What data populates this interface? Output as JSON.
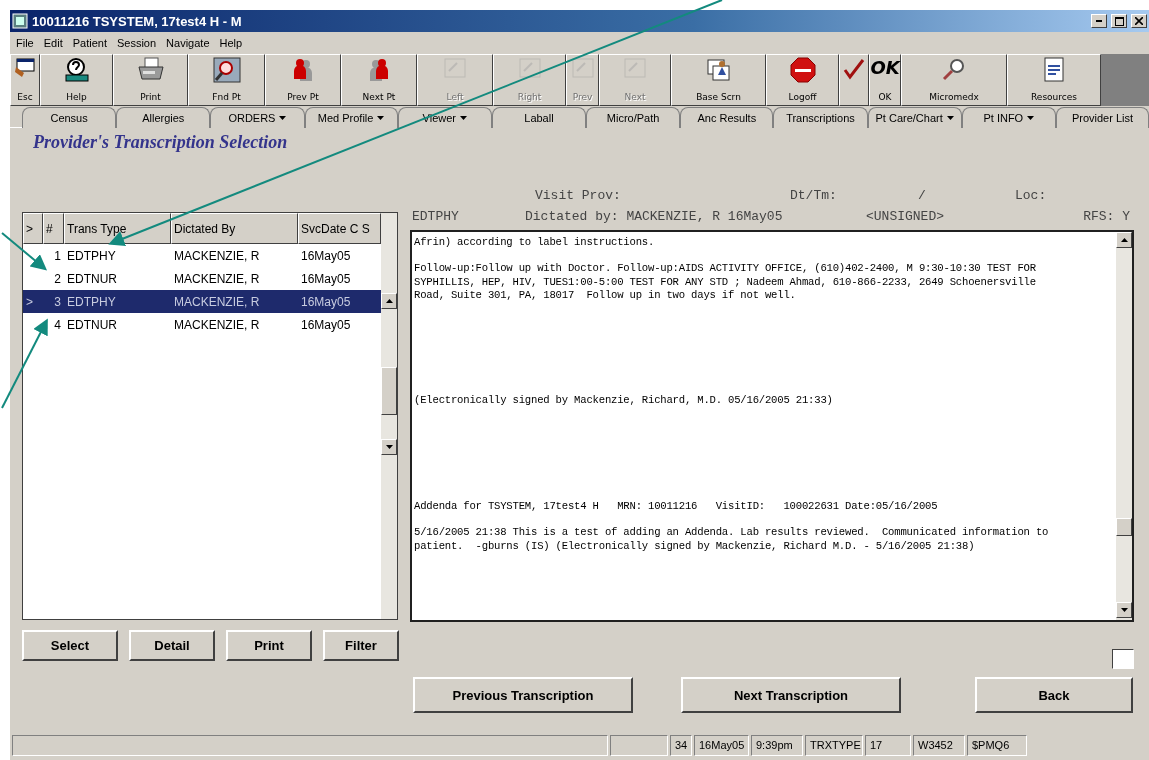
{
  "window": {
    "title": "10011216 TSYSTEM, 17test4 H - M"
  },
  "menu": [
    "File",
    "Edit",
    "Patient",
    "Session",
    "Navigate",
    "Help"
  ],
  "toolbar": [
    {
      "label": "Esc",
      "kind": "esc",
      "disabled": false
    },
    {
      "label": "Help",
      "kind": "help",
      "disabled": false
    },
    {
      "label": "Print",
      "kind": "print",
      "disabled": false
    },
    {
      "label": "Fnd Pt",
      "kind": "find",
      "disabled": false
    },
    {
      "label": "Prev Pt",
      "kind": "prevpt",
      "disabled": false
    },
    {
      "label": "Next Pt",
      "kind": "nextpt",
      "disabled": false
    },
    {
      "label": "Left",
      "kind": "page",
      "disabled": true
    },
    {
      "label": "Right",
      "kind": "page",
      "disabled": true
    },
    {
      "label": "Prev",
      "kind": "page",
      "disabled": true
    },
    {
      "label": "Next",
      "kind": "page",
      "disabled": true
    },
    {
      "label": "Base Scrn",
      "kind": "base",
      "disabled": false
    },
    {
      "label": "Logoff",
      "kind": "stop",
      "disabled": false
    },
    {
      "kind": "check",
      "disabled": false
    },
    {
      "label": "OK",
      "kind": "ok",
      "glyph": "OK",
      "disabled": false
    },
    {
      "label": "Micromedx",
      "kind": "magnifier",
      "disabled": false
    },
    {
      "label": "Resources",
      "kind": "document",
      "disabled": false
    }
  ],
  "tabs": [
    {
      "label": "Census",
      "dropdown": false
    },
    {
      "label": "Allergies",
      "dropdown": false
    },
    {
      "label": "ORDERS",
      "dropdown": true
    },
    {
      "label": "Med Profile",
      "dropdown": true
    },
    {
      "label": "Viewer",
      "dropdown": true
    },
    {
      "label": "Laball",
      "dropdown": false
    },
    {
      "label": "Micro/Path",
      "dropdown": false
    },
    {
      "label": "Anc Results",
      "dropdown": false
    },
    {
      "label": "Transcriptions",
      "dropdown": false
    },
    {
      "label": "Pt Care/Chart",
      "dropdown": true
    },
    {
      "label": "Pt INFO",
      "dropdown": true
    },
    {
      "label": "Provider List",
      "dropdown": false
    }
  ],
  "heading": "Provider's Transcription Selection",
  "table": {
    "columns": [
      ">",
      "#",
      "Trans Type",
      "Dictated By",
      "SvcDate C S"
    ],
    "rows": [
      {
        "num": "1",
        "type": "EDTPHY",
        "by": "MACKENZIE, R",
        "date": "16May05",
        "selected": false
      },
      {
        "num": "2",
        "type": "EDTNUR",
        "by": "MACKENZIE, R",
        "date": "16May05",
        "selected": false
      },
      {
        "pointer": ">",
        "num": "3",
        "type": "EDTPHY",
        "by": "MACKENZIE, R",
        "date": "16May05",
        "selected": true
      },
      {
        "num": "4",
        "type": "EDTNUR",
        "by": "MACKENZIE, R",
        "date": "16May05",
        "selected": false
      }
    ]
  },
  "list_buttons": [
    "Select",
    "Detail",
    "Print",
    "Filter"
  ],
  "header_line_1": [
    "Visit Prov:",
    "Dt/Tm:",
    "/",
    "Loc:"
  ],
  "header_line_2": [
    "EDTPHY",
    "Dictated by: MACKENZIE, R 16May05",
    "<UNSIGNED>",
    "RFS: Y"
  ],
  "transcription": "Afrin) according to label instructions.\n\nFollow-up:Follow up with Doctor. Follow-up:AIDS ACTIVITY OFFICE, (610)402-2400, M 9:30-10:30 TEST FOR\nSYPHILLIS, HEP, HIV, TUES1:00-5:00 TEST FOR ANY STD ; Nadeem Ahmad, 610-866-2233, 2649 Schoenersville\nRoad, Suite 301, PA, 18017  Follow up in two days if not well.\n\n\n\n\n\n\n\n(Electronically signed by Mackenzie, Richard, M.D. 05/16/2005 21:33)\n\n\n\n\n\n\n\nAddenda for TSYSTEM, 17test4 H   MRN: 10011216   VisitID:   100022631 Date:05/16/2005\n\n5/16/2005 21:38 This is a test of adding an Addenda. Lab results reviewed.  Communicated information to\npatient.  -gburns (IS) (Electronically signed by Mackenzie, Richard M.D. - 5/16/2005 21:38)",
  "nav_buttons": [
    "Previous Transcription",
    "Next Transcription",
    "Back"
  ],
  "status_bar": [
    "34",
    "16May05",
    "9:39pm",
    "TRXTYPE",
    "17",
    "W3452",
    "$PMQ6"
  ]
}
